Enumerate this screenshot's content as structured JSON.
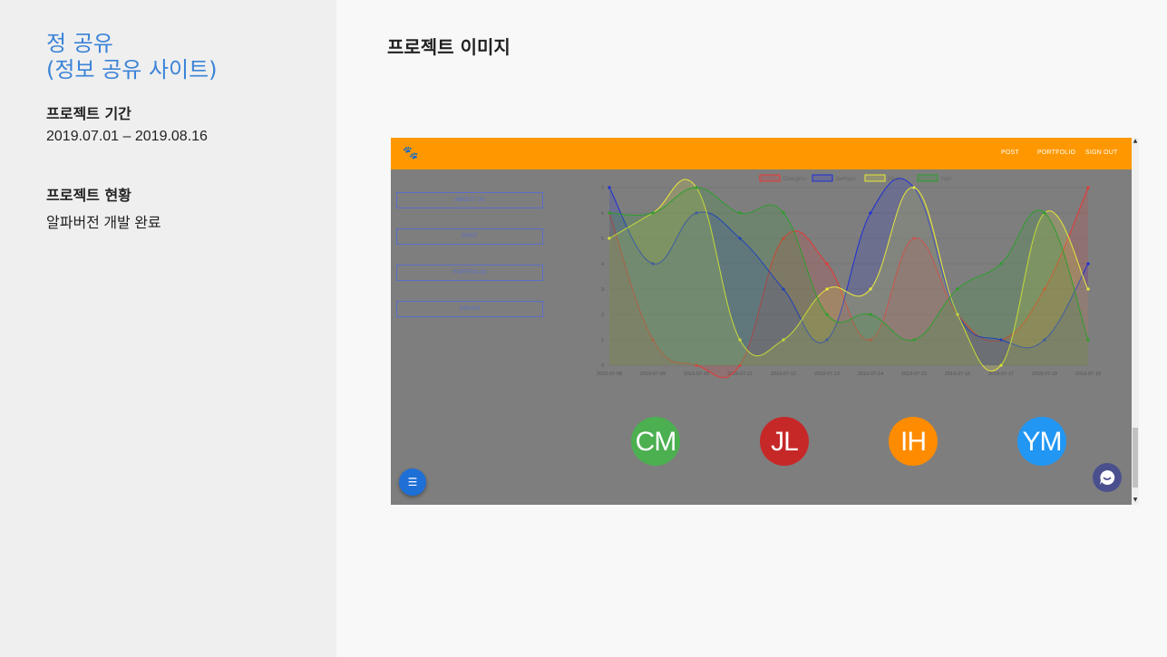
{
  "sidebar": {
    "title_line1": "정 공유",
    "title_line2": "(정보 공유 사이트)",
    "period_label": "프로젝트 기간",
    "period_value": "2019.07.01 – 2019.08.16",
    "status_label": "프로젝트 현황",
    "status_value": "알파버전 개발 완료"
  },
  "main": {
    "title": "프로젝트 이미지"
  },
  "screenshot": {
    "nav": [
      "POST",
      "PORTFOLIO",
      "SIGN OUT"
    ],
    "side_buttons": [
      "ABOUT US",
      "POST",
      "PORTFOLIO",
      "GRAPH"
    ],
    "avatars": [
      {
        "initials": "CM",
        "color": "#4caf50"
      },
      {
        "initials": "JL",
        "color": "#c62828"
      },
      {
        "initials": "IH",
        "color": "#ff8c00"
      },
      {
        "initials": "YM",
        "color": "#2196f3"
      }
    ],
    "fab_icon": "list-icon",
    "chat_icon": "chat-bubble-icon"
  },
  "chart_data": {
    "type": "area",
    "categories": [
      "2019-07-08",
      "2019-07-09",
      "2019-07-10",
      "2019-07-11",
      "2019-07-12",
      "2019-07-13",
      "2019-07-14",
      "2019-07-15",
      "2019-07-16",
      "2019-07-17",
      "2019-07-18",
      "2019-07-19"
    ],
    "series": [
      {
        "name": "Changmo",
        "color": "#e53935",
        "values": [
          6,
          1,
          0,
          0,
          5,
          4,
          1,
          5,
          2,
          1,
          3,
          7
        ]
      },
      {
        "name": "Jaehyun",
        "color": "#1e2fd6",
        "values": [
          7,
          4,
          6,
          5,
          3,
          1,
          6,
          7,
          2,
          1,
          1,
          4
        ]
      },
      {
        "name": "Inho",
        "color": "#e8e83a",
        "values": [
          5,
          6,
          7,
          1,
          1,
          3,
          3,
          7,
          2,
          0,
          6,
          3
        ]
      },
      {
        "name": "Yejin",
        "color": "#2e9e2e",
        "values": [
          6,
          6,
          7,
          6,
          6,
          2,
          2,
          1,
          3,
          4,
          6,
          1
        ]
      }
    ],
    "ylim": [
      0,
      7
    ],
    "yticks": [
      "0",
      "1",
      "2",
      "3",
      "4",
      "5",
      "6",
      "7"
    ],
    "legend": "top"
  }
}
